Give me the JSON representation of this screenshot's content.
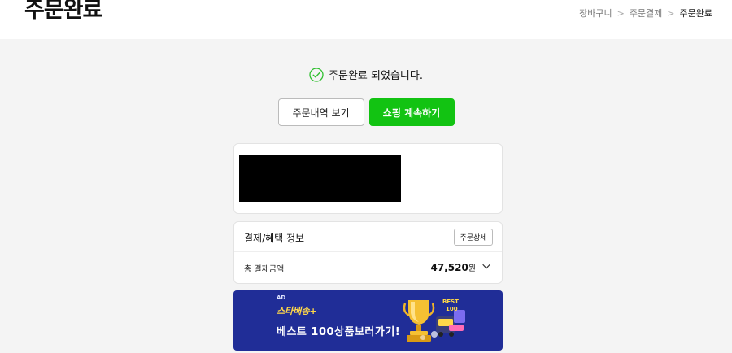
{
  "header": {
    "title": "주문완료",
    "breadcrumb": [
      "장바구니",
      "주문결제",
      "주문완료"
    ]
  },
  "status": {
    "message": "주문완료 되었습니다."
  },
  "actions": {
    "view_orders_label": "주문내역 보기",
    "continue_shopping_label": "쇼핑 계속하기"
  },
  "payment": {
    "section_title": "결제/혜택 정보",
    "detail_button_label": "주문상세",
    "total_label": "총 결제금액",
    "total_amount": "47,520",
    "total_unit": "원"
  },
  "banner": {
    "ad_label": "AD",
    "brand": "스타배송",
    "brand_mark": "+",
    "headline": "베스트 100상품보러가기!",
    "badge_text_top": "BEST",
    "badge_text_bottom": "100"
  },
  "colors": {
    "accent_green": "#12c312",
    "banner_bg": "#202d97",
    "brand_yellow": "#ffd84a"
  }
}
